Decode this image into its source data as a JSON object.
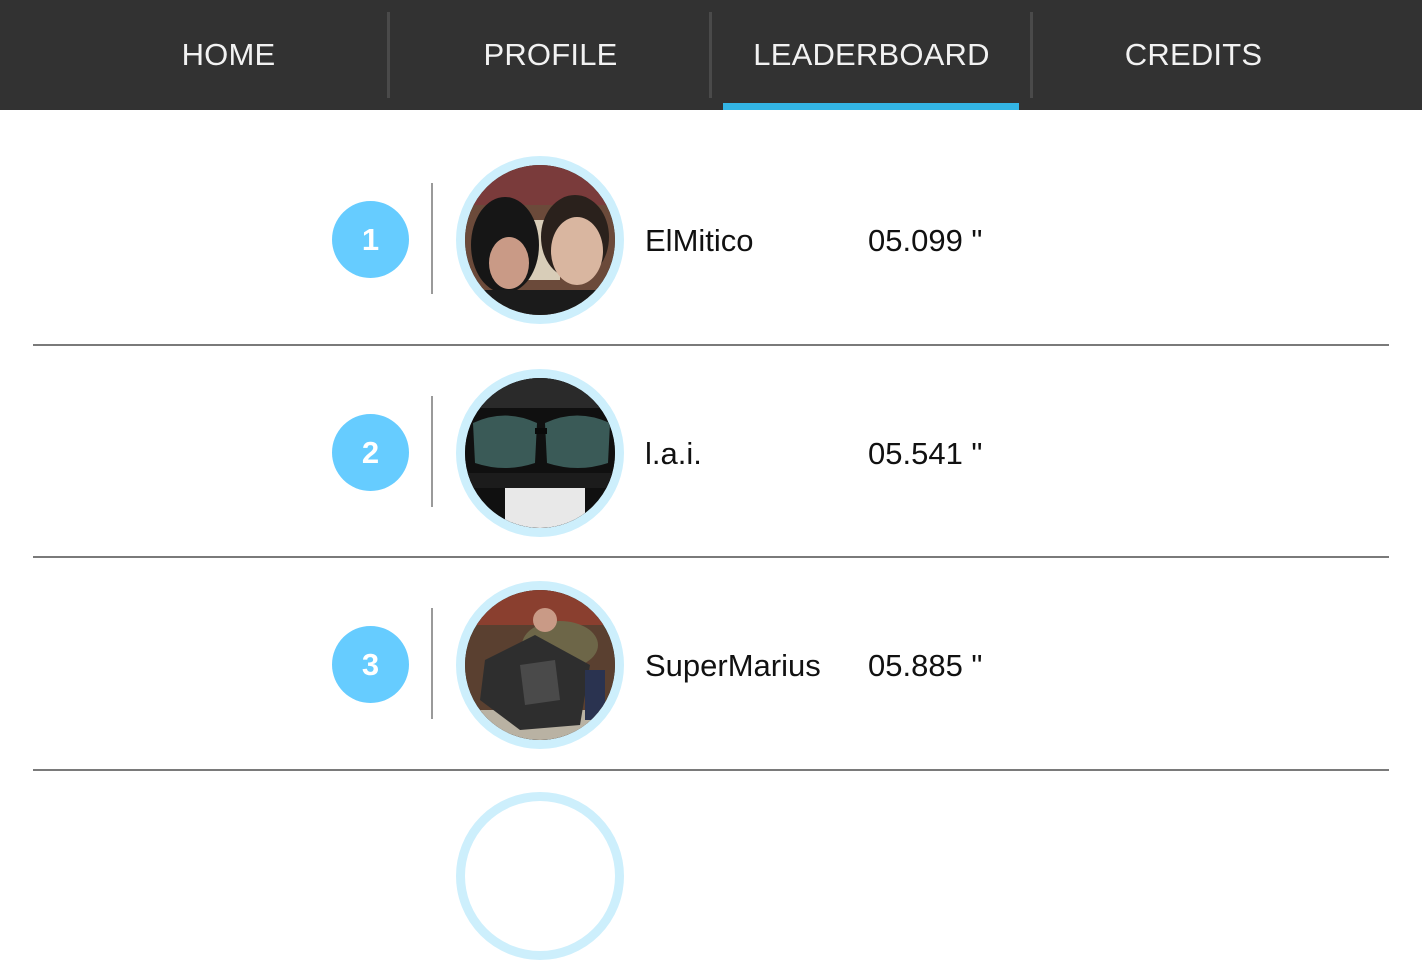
{
  "tabs": [
    {
      "label": "HOME"
    },
    {
      "label": "PROFILE"
    },
    {
      "label": "LEADERBOARD",
      "active": true
    },
    {
      "label": "CREDITS"
    }
  ],
  "colors": {
    "tabbar_bg": "#323232",
    "active_indicator": "#33b5e5",
    "rank_badge": "#66ccff",
    "avatar_ring": "#cdeffc"
  },
  "leaderboard": {
    "entries": [
      {
        "rank": "1",
        "username": "ElMitico",
        "score": "05.099 \"",
        "avatar": "avatar-photo-couple"
      },
      {
        "rank": "2",
        "username": "l.a.i.",
        "score": "05.541 \"",
        "avatar": "avatar-photo-sunglasses"
      },
      {
        "rank": "3",
        "username": "SuperMarius",
        "score": "05.885 \"",
        "avatar": "avatar-photo-giant-dice"
      }
    ]
  }
}
